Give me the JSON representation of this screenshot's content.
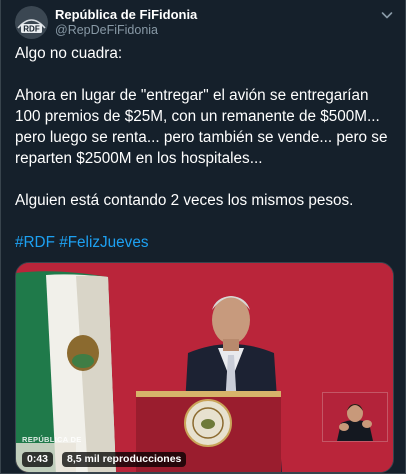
{
  "author": {
    "name": "República de FiFidonia",
    "handle": "@RepDeFiFidonia",
    "avatar_text": "RDF"
  },
  "tweet": {
    "line1": "Algo no cuadra:",
    "paragraph2": "Ahora en lugar de \"entregar\" el avión se entregarían 100 premios de $25M, con un remanente de $500M... pero luego se renta... pero también se vende... pero se reparten $2500M en los hospitales...",
    "paragraph3": "Alguien está contando 2 veces los mismos pesos.",
    "hashtags": [
      "#RDF",
      "#FelizJueves"
    ]
  },
  "media": {
    "duration": "0:43",
    "views": "8,5 mil reproducciones",
    "watermark": "REPÚBLICA DE"
  },
  "icons": {
    "caret": "chevron-down-icon"
  },
  "colors": {
    "background": "#15202b",
    "link": "#1da1f2",
    "secondary_text": "#8899a6",
    "border": "#38444d"
  }
}
